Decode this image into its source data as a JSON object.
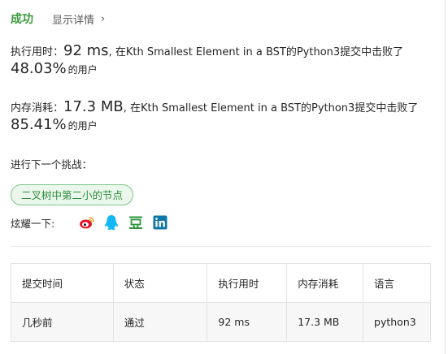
{
  "header": {
    "status": "成功",
    "details_link": "显示详情"
  },
  "runtime": {
    "label": "执行用时：",
    "value": "92 ms",
    "sentence": ", 在Kth Smallest Element in a BST的Python3提交中击败了",
    "percent": "48.03%",
    "suffix": "的用户"
  },
  "memory": {
    "label": "内存消耗：",
    "value": "17.3 MB",
    "sentence": ", 在Kth Smallest Element in a BST的Python3提交中击败了",
    "percent": "85.41%",
    "suffix": "的用户"
  },
  "next_challenge": {
    "label": "进行下一个挑战：",
    "item": "二叉树中第二小的节点"
  },
  "share": {
    "label": "炫耀一下:",
    "icons": [
      "weibo-icon",
      "qq-icon",
      "douban-icon",
      "linkedin-icon"
    ],
    "colors": {
      "weibo": "#e6162d",
      "qq": "#12b7f5",
      "douban": "#2e963d",
      "linkedin": "#0e76a8"
    }
  },
  "table": {
    "headers": [
      "提交时间",
      "状态",
      "执行用时",
      "内存消耗",
      "语言"
    ],
    "rows": [
      [
        "几秒前",
        "通过",
        "92 ms",
        "17.3 MB",
        "python3"
      ]
    ]
  },
  "colors": {
    "success": "#3a9a3e",
    "chip_bg": "#ebf7ec",
    "chip_border": "#7cc48a"
  }
}
